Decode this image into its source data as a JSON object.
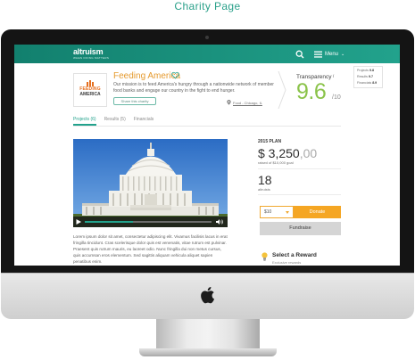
{
  "caption": "Charity Page",
  "colors": {
    "brand_teal": "#22a28c",
    "score_green": "#8bc34a",
    "donate_orange": "#f5a623",
    "charity_orange": "#e59a2e"
  },
  "topbar": {
    "logo": "altruism",
    "logo_tagline": "WHEN DOING MATTERS",
    "search_icon": "search-icon",
    "menu_icon": "hamburger-icon",
    "menu_label": "Menu"
  },
  "org": {
    "logo_line1": "FEEDING",
    "logo_line2": "AMERICA",
    "name": "Feeding America",
    "mission": "Our mission is to feed America's hungry through a nationwide network of member food banks and engage our country in the fight to end hunger.",
    "share_label": "Share this charity",
    "location": "Food - Chicago, IL"
  },
  "transparency": {
    "label": "Transparency",
    "score": "9.6",
    "out_of": "/10",
    "breakdown": [
      {
        "label": "Projects",
        "value": "9.8"
      },
      {
        "label": "Results",
        "value": "9.7"
      },
      {
        "label": "Financials",
        "value": "8.9"
      }
    ]
  },
  "tabs": [
    {
      "label": "Projects (6)",
      "active": true
    },
    {
      "label": "Results (5)",
      "active": false
    },
    {
      "label": "Financials",
      "active": false
    }
  ],
  "video": {
    "progress": 0.38
  },
  "body_text": "Lorem ipsum dolor sit amet, consectetur adipiscing elit. Vivamus facilisis lacus in erat fringilla tincidunt. Cras scelerisque dolor quis est venenatis, vitae rutrum est pulvinar. Praesent quis rutrum mauris, eu laoreet odio. Nunc fringilla dui non metus cursus, quis accumsan eros elementum. Sed sagittis aliquam vehicula aliquet sapien penatibus enim.",
  "plan": {
    "label": "2015 PLAN",
    "amount": "$ 3,250",
    "cents": ",00",
    "goal_text": "raised of $10,000 goal",
    "altruists_count": "18",
    "altruists_label": "altruists"
  },
  "donate": {
    "selected_amount": "$10",
    "button_label": "Donate",
    "fundraise_label": "Fundraise"
  },
  "reward": {
    "title": "Select a Reward",
    "subtitle": "Exclusive rewards"
  }
}
